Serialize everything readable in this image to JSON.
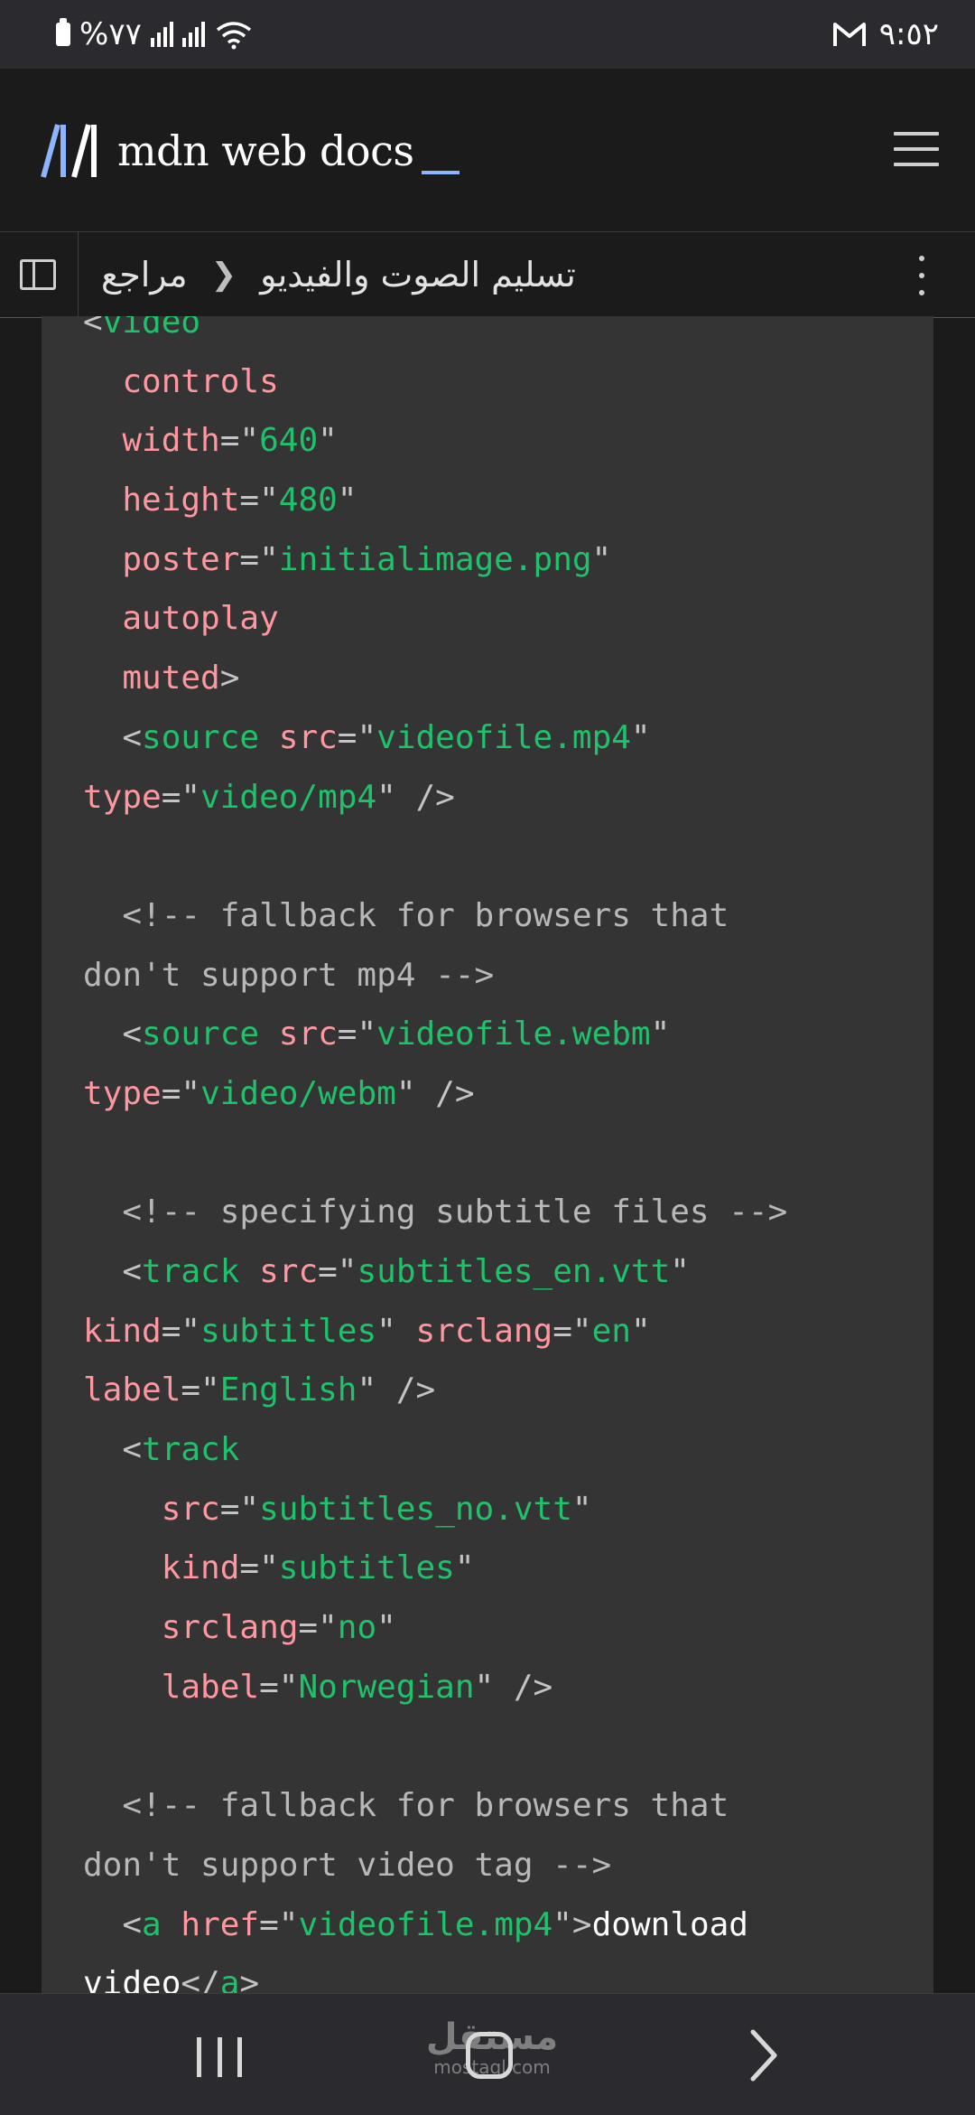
{
  "status_bar": {
    "battery_text": "%٧٧",
    "time": "٩:٥٢",
    "icons": [
      "battery-icon",
      "signal-icon",
      "signal-icon",
      "wifi-icon",
      "gmail-icon"
    ]
  },
  "header": {
    "logo_text": "mdn web docs",
    "menu_icon": "hamburger-menu-icon"
  },
  "breadcrumb": {
    "items": [
      "تسليم الصوت والفيديو",
      "مراجع"
    ],
    "separator_icon": "chevron-icon",
    "sidebar_icon": "sidebar-toggle-icon",
    "more_icon": "more-vert-icon"
  },
  "code": {
    "lines": [
      [
        [
          "p",
          "<"
        ],
        [
          "tag",
          "video"
        ]
      ],
      [
        [
          "p",
          "  "
        ],
        [
          "attr",
          "controls"
        ]
      ],
      [
        [
          "p",
          "  "
        ],
        [
          "attr",
          "width"
        ],
        [
          "p",
          "=\""
        ],
        [
          "val",
          "640"
        ],
        [
          "p",
          "\""
        ]
      ],
      [
        [
          "p",
          "  "
        ],
        [
          "attr",
          "height"
        ],
        [
          "p",
          "=\""
        ],
        [
          "val",
          "480"
        ],
        [
          "p",
          "\""
        ]
      ],
      [
        [
          "p",
          "  "
        ],
        [
          "attr",
          "poster"
        ],
        [
          "p",
          "=\""
        ],
        [
          "val",
          "initialimage.png"
        ],
        [
          "p",
          "\""
        ]
      ],
      [
        [
          "p",
          "  "
        ],
        [
          "attr",
          "autoplay"
        ]
      ],
      [
        [
          "p",
          "  "
        ],
        [
          "attr",
          "muted"
        ],
        [
          "p",
          ">"
        ]
      ],
      [
        [
          "p",
          "  <"
        ],
        [
          "tag",
          "source"
        ],
        [
          "p",
          " "
        ],
        [
          "attr",
          "src"
        ],
        [
          "p",
          "=\""
        ],
        [
          "val",
          "videofile.mp4"
        ],
        [
          "p",
          "\""
        ]
      ],
      [
        [
          "attr",
          "type"
        ],
        [
          "p",
          "=\""
        ],
        [
          "val",
          "video/mp4"
        ],
        [
          "p",
          "\" />"
        ]
      ],
      [],
      [
        [
          "com",
          "  <!-- fallback for browsers that"
        ]
      ],
      [
        [
          "com",
          "don't support mp4 -->"
        ]
      ],
      [
        [
          "p",
          "  <"
        ],
        [
          "tag",
          "source"
        ],
        [
          "p",
          " "
        ],
        [
          "attr",
          "src"
        ],
        [
          "p",
          "=\""
        ],
        [
          "val",
          "videofile.webm"
        ],
        [
          "p",
          "\""
        ]
      ],
      [
        [
          "attr",
          "type"
        ],
        [
          "p",
          "=\""
        ],
        [
          "val",
          "video/webm"
        ],
        [
          "p",
          "\" />"
        ]
      ],
      [],
      [
        [
          "com",
          "  <!-- specifying subtitle files -->"
        ]
      ],
      [
        [
          "p",
          "  <"
        ],
        [
          "tag",
          "track"
        ],
        [
          "p",
          " "
        ],
        [
          "attr",
          "src"
        ],
        [
          "p",
          "=\""
        ],
        [
          "val",
          "subtitles_en.vtt"
        ],
        [
          "p",
          "\""
        ]
      ],
      [
        [
          "attr",
          "kind"
        ],
        [
          "p",
          "=\""
        ],
        [
          "val",
          "subtitles"
        ],
        [
          "p",
          "\" "
        ],
        [
          "attr",
          "srclang"
        ],
        [
          "p",
          "=\""
        ],
        [
          "val",
          "en"
        ],
        [
          "p",
          "\""
        ]
      ],
      [
        [
          "attr",
          "label"
        ],
        [
          "p",
          "=\""
        ],
        [
          "val",
          "English"
        ],
        [
          "p",
          "\" />"
        ]
      ],
      [
        [
          "p",
          "  <"
        ],
        [
          "tag",
          "track"
        ]
      ],
      [
        [
          "p",
          "    "
        ],
        [
          "attr",
          "src"
        ],
        [
          "p",
          "=\""
        ],
        [
          "val",
          "subtitles_no.vtt"
        ],
        [
          "p",
          "\""
        ]
      ],
      [
        [
          "p",
          "    "
        ],
        [
          "attr",
          "kind"
        ],
        [
          "p",
          "=\""
        ],
        [
          "val",
          "subtitles"
        ],
        [
          "p",
          "\""
        ]
      ],
      [
        [
          "p",
          "    "
        ],
        [
          "attr",
          "srclang"
        ],
        [
          "p",
          "=\""
        ],
        [
          "val",
          "no"
        ],
        [
          "p",
          "\""
        ]
      ],
      [
        [
          "p",
          "    "
        ],
        [
          "attr",
          "label"
        ],
        [
          "p",
          "=\""
        ],
        [
          "val",
          "Norwegian"
        ],
        [
          "p",
          "\" />"
        ]
      ],
      [],
      [
        [
          "com",
          "  <!-- fallback for browsers that"
        ]
      ],
      [
        [
          "com",
          "don't support video tag -->"
        ]
      ],
      [
        [
          "p",
          "  <"
        ],
        [
          "tag",
          "a"
        ],
        [
          "p",
          " "
        ],
        [
          "attr",
          "href"
        ],
        [
          "p",
          "=\""
        ],
        [
          "val",
          "videofile.mp4"
        ],
        [
          "p",
          "\">"
        ],
        [
          "text",
          "download"
        ]
      ],
      [
        [
          "text",
          "video"
        ],
        [
          "p",
          "</"
        ],
        [
          "tag",
          "a"
        ],
        [
          "p",
          ">"
        ]
      ]
    ]
  },
  "nav_bar": {
    "watermark_ar": "مستقل",
    "watermark_en": "mostaql.com",
    "icons": [
      "recent-apps-icon",
      "home-icon",
      "forward-icon"
    ]
  },
  "colors": {
    "tag": "#1fc16b",
    "attr": "#ff97a0",
    "value": "#1fc16b",
    "comment": "#b8b8b8",
    "code_bg": "#343434",
    "page_bg": "#1b1b1b",
    "logo_accent": "#8cb4ff"
  }
}
